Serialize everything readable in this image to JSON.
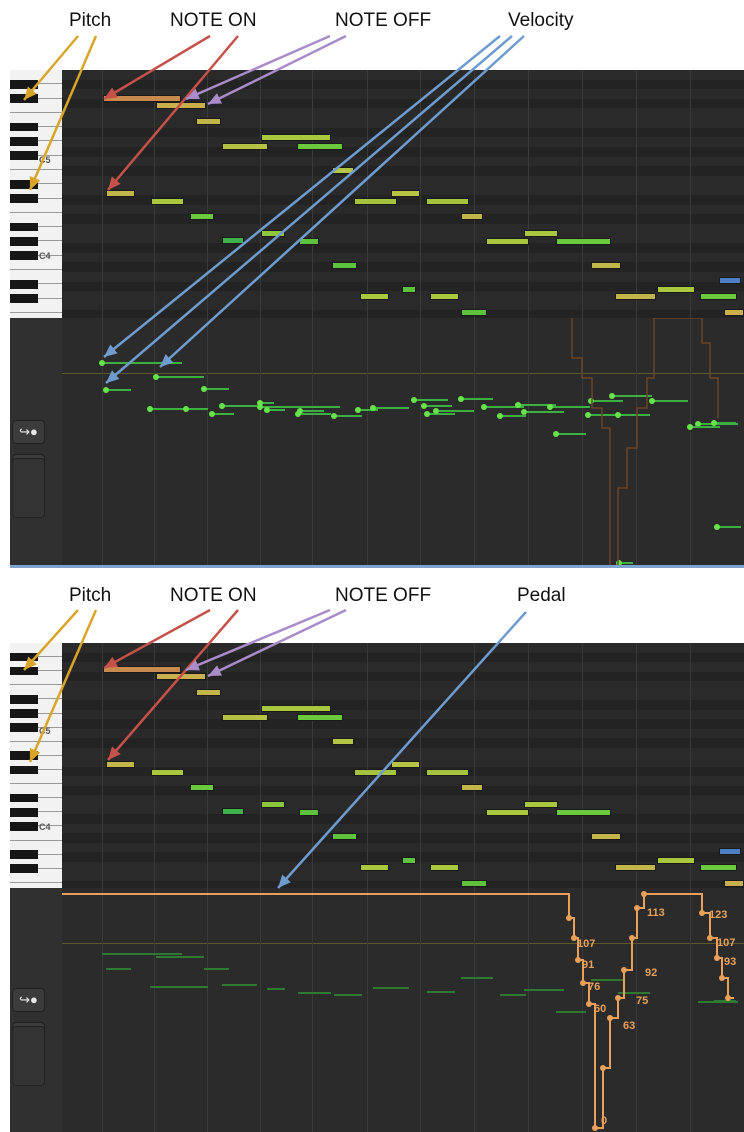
{
  "top": {
    "labels": {
      "pitch": "Pitch",
      "note_on": "NOTE ON",
      "note_off": "NOTE OFF",
      "velocity": "Velocity"
    },
    "octave_labels": {
      "c5": "C5",
      "c4": "C4"
    }
  },
  "bottom": {
    "labels": {
      "pitch": "Pitch",
      "note_on": "NOTE ON",
      "note_off": "NOTE OFF",
      "pedal": "Pedal"
    },
    "octave_labels": {
      "c5": "C5",
      "c4": "C4"
    },
    "pedal_values": [
      "107",
      "91",
      "76",
      "60",
      "0",
      "63",
      "75",
      "92",
      "113",
      "123",
      "107",
      "93"
    ]
  },
  "icons": {
    "automation": "curved-arrow-icon",
    "selector": "up-down-chevron-icon"
  },
  "colors": {
    "arrow_yellow": "#d8a52a",
    "arrow_red": "#c5524a",
    "arrow_purple": "#a98cc9",
    "arrow_blue": "#6f9ccf",
    "velocity_green": "#67e34b",
    "pedal_orange": "#e9a05a",
    "grid_line": "#2f8a3a"
  }
}
